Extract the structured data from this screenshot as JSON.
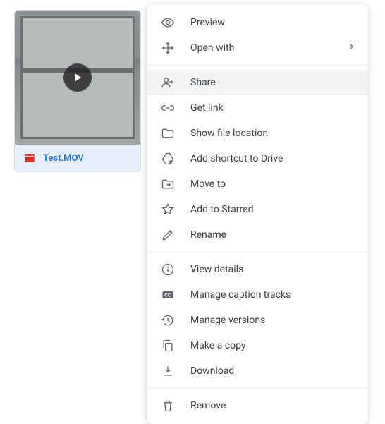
{
  "file": {
    "name": "Test.MOV",
    "icon": "video-file-icon"
  },
  "menu": {
    "groups": [
      [
        {
          "key": "preview",
          "icon": "eye-icon",
          "label": "Preview",
          "submenu": false
        },
        {
          "key": "openwith",
          "icon": "move-arrows-icon",
          "label": "Open with",
          "submenu": true
        }
      ],
      [
        {
          "key": "share",
          "icon": "person-add-icon",
          "label": "Share",
          "submenu": false,
          "selected": true
        },
        {
          "key": "getlink",
          "icon": "link-icon",
          "label": "Get link",
          "submenu": false
        },
        {
          "key": "location",
          "icon": "folder-icon",
          "label": "Show file location",
          "submenu": false
        },
        {
          "key": "shortcut",
          "icon": "drive-add-icon",
          "label": "Add shortcut to Drive",
          "submenu": false
        },
        {
          "key": "moveto",
          "icon": "folder-move-icon",
          "label": "Move to",
          "submenu": false
        },
        {
          "key": "star",
          "icon": "star-icon",
          "label": "Add to Starred",
          "submenu": false
        },
        {
          "key": "rename",
          "icon": "pencil-icon",
          "label": "Rename",
          "submenu": false
        }
      ],
      [
        {
          "key": "details",
          "icon": "info-icon",
          "label": "View details",
          "submenu": false
        },
        {
          "key": "captions",
          "icon": "captions-icon",
          "label": "Manage caption tracks",
          "submenu": false
        },
        {
          "key": "versions",
          "icon": "history-icon",
          "label": "Manage versions",
          "submenu": false
        },
        {
          "key": "copy",
          "icon": "copy-icon",
          "label": "Make a copy",
          "submenu": false
        },
        {
          "key": "download",
          "icon": "download-icon",
          "label": "Download",
          "submenu": false
        }
      ],
      [
        {
          "key": "remove",
          "icon": "trash-icon",
          "label": "Remove",
          "submenu": false
        }
      ]
    ]
  }
}
